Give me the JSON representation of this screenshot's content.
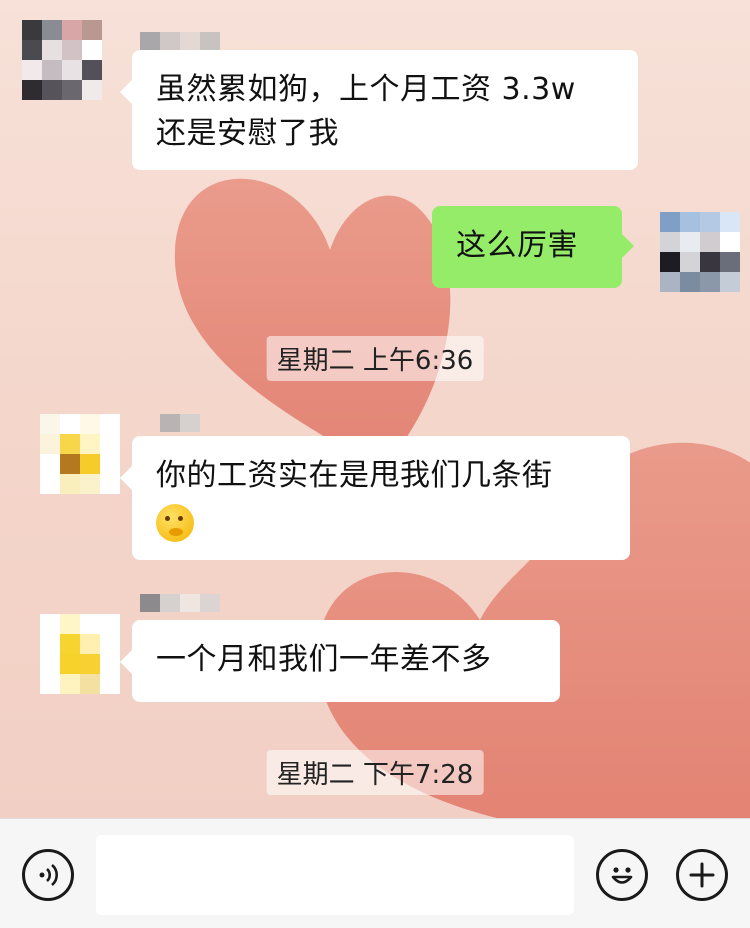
{
  "messages": [
    {
      "side": "left",
      "text_line1": "虽然累如狗，上个月工资 3.3w",
      "text_line2": "还是安慰了我"
    },
    {
      "side": "right",
      "text": "这么厉害"
    },
    {
      "side": "left",
      "text_line1": "你的工资实在是甩我们几条街",
      "emoji": "thinking-face-emoji"
    },
    {
      "side": "left",
      "text": "一个月和我们一年差不多"
    }
  ],
  "timestamps": [
    "星期二 上午6:36",
    "星期二 下午7:28"
  ],
  "input": {
    "value": "",
    "placeholder": ""
  },
  "colors": {
    "sent_bubble": "#95ec69",
    "received_bubble": "#ffffff",
    "background": "#f6ddd3"
  },
  "icons": {
    "voice": "voice-icon",
    "emoji": "emoji-icon",
    "add": "plus-icon"
  }
}
